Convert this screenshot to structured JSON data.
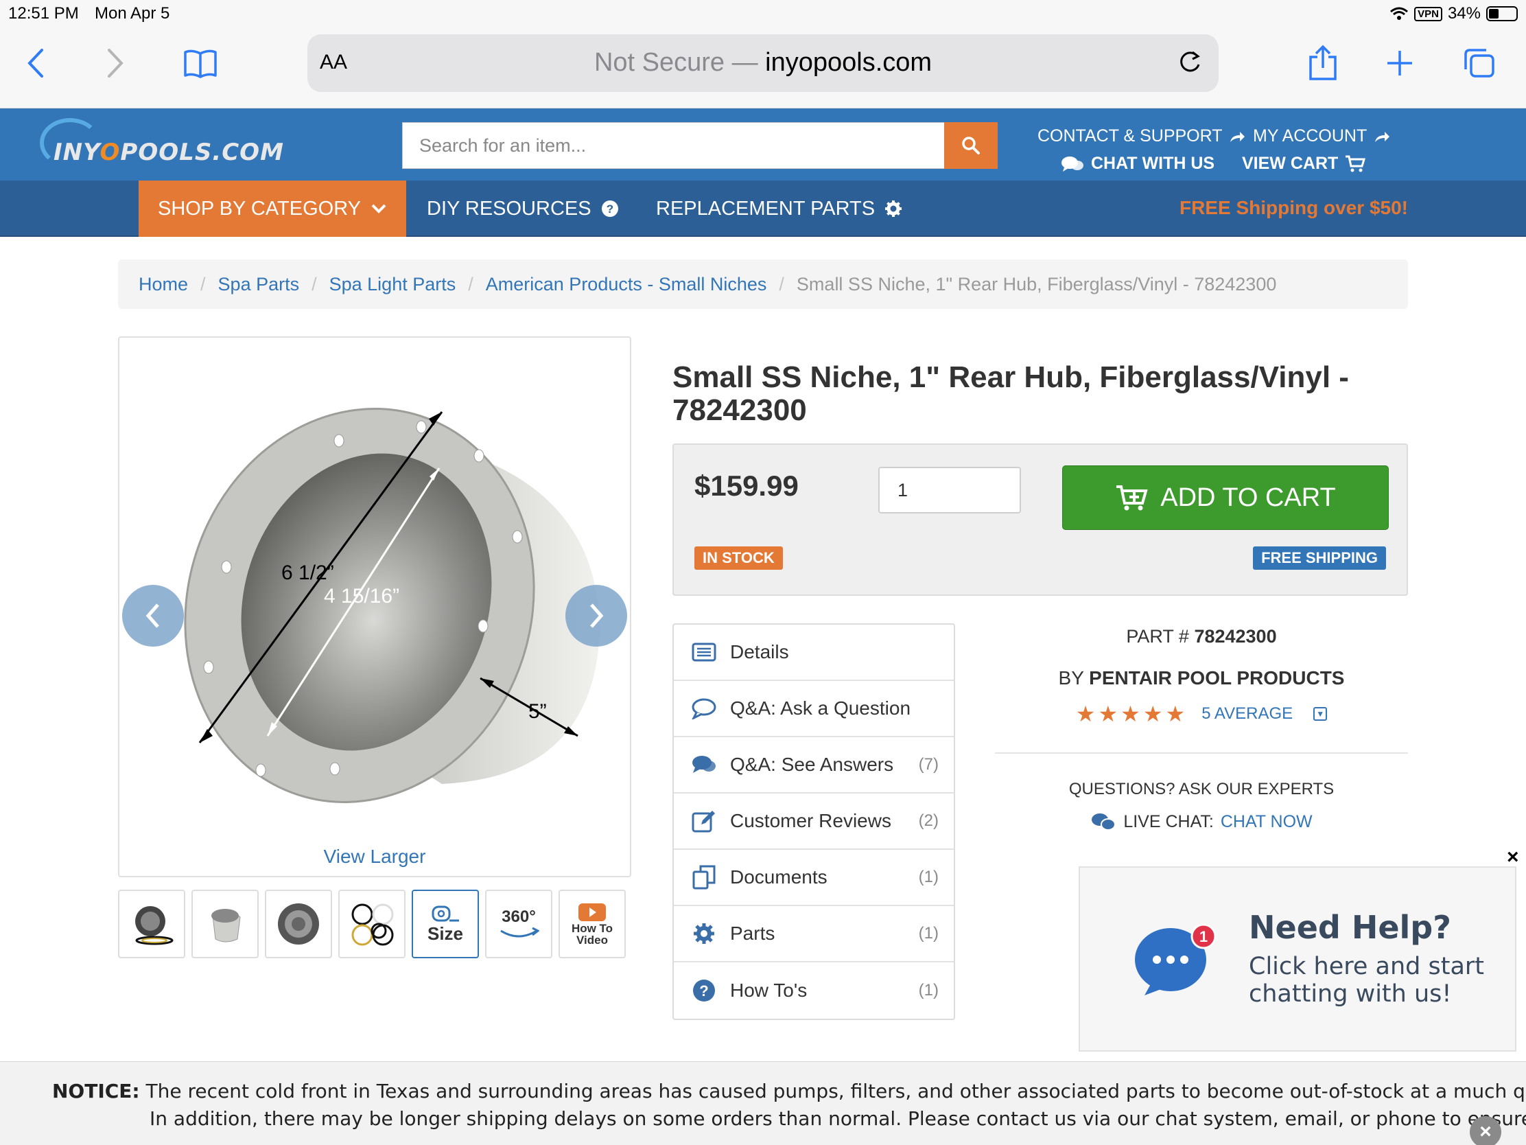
{
  "status_bar": {
    "time": "12:51 PM",
    "date": "Mon Apr 5",
    "vpn": "VPN",
    "battery": "34%"
  },
  "browser": {
    "text_size_label": "AA",
    "security_label": "Not Secure —",
    "host": "inyopools.com"
  },
  "site": {
    "logo_prefix": "INY",
    "logo_o": "O",
    "logo_suffix": "POOLS.COM",
    "search_placeholder": "Search for an item...",
    "header_links": {
      "contact": "CONTACT & SUPPORT",
      "account": "MY ACCOUNT",
      "chat": "CHAT WITH US",
      "cart": "VIEW CART"
    },
    "nav": {
      "shop": "SHOP BY CATEGORY",
      "diy": "DIY RESOURCES",
      "replacement": "REPLACEMENT PARTS",
      "promo": "FREE Shipping over $50!"
    }
  },
  "breadcrumb": {
    "items": [
      "Home",
      "Spa Parts",
      "Spa Light Parts",
      "American Products - Small Niches"
    ],
    "current": "Small SS Niche, 1\" Rear Hub, Fiberglass/Vinyl - 78242300"
  },
  "gallery": {
    "dim_outer": "6 1/2”",
    "dim_inner": "4 15/16”",
    "dim_depth": "5”",
    "view_larger": "View Larger",
    "thumbs": {
      "size_label": "Size",
      "deg_label": "360°",
      "howto_line1": "How To",
      "howto_line2": "Video"
    }
  },
  "product": {
    "title": "Small SS Niche, 1\" Rear Hub, Fiberglass/Vinyl - 78242300",
    "price": "$159.99",
    "quantity": "1",
    "add_to_cart": "ADD TO CART",
    "stock": "IN STOCK",
    "shipping": "FREE SHIPPING",
    "part_label": "PART #",
    "part_number": "78242300",
    "by_label": "BY",
    "brand": "PENTAIR POOL PRODUCTS",
    "rating_value": 5,
    "rating_text": "5 AVERAGE",
    "ask_experts": "QUESTIONS? ASK OUR EXPERTS",
    "live_chat_label": "LIVE CHAT:",
    "chat_now": "CHAT NOW"
  },
  "tabs": [
    {
      "label": "Details",
      "count": ""
    },
    {
      "label": "Q&A: Ask a Question",
      "count": ""
    },
    {
      "label": "Q&A: See Answers",
      "count": "(7)"
    },
    {
      "label": "Customer Reviews",
      "count": "(2)"
    },
    {
      "label": "Documents",
      "count": "(1)"
    },
    {
      "label": "Parts",
      "count": "(1)"
    },
    {
      "label": "How To's",
      "count": "(1)"
    }
  ],
  "help_widget": {
    "close": "×",
    "badge": "1",
    "title": "Need Help?",
    "text": "Click here and start chatting with us!"
  },
  "notice": {
    "label": "NOTICE:",
    "line1": "The recent cold front in Texas and surrounding areas has caused pumps, filters, and other associated parts to become out-of-stock at a much quicker rate th",
    "line2": "In addition, there may be longer shipping delays on some orders than normal. Please contact us via our chat system, email, or phone to ensure a smooth c",
    "close": "×"
  },
  "colors": {
    "brand_blue": "#3276b8",
    "nav_blue": "#2c5f95",
    "accent_orange": "#e47936",
    "cart_green": "#3d9b2d"
  }
}
